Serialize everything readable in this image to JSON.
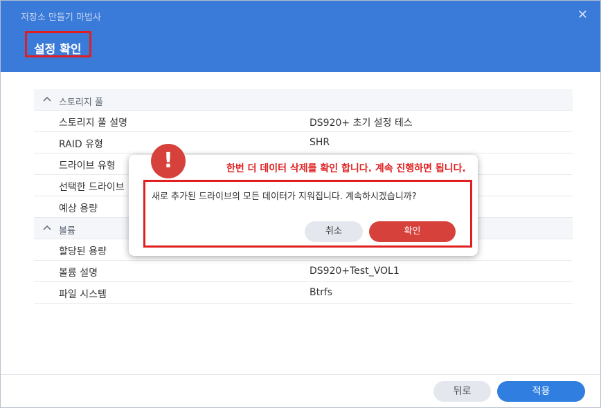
{
  "window": {
    "title": "저장소 만들기 마법사",
    "close_icon": "close-icon",
    "step_title": "설정 확인"
  },
  "sections": [
    {
      "title": "스토리지 풀",
      "rows": [
        {
          "key": "스토리지 풀 설명",
          "value": "DS920+ 초기 설정 테스"
        },
        {
          "key": "RAID 유형",
          "value": "SHR"
        },
        {
          "key": "드라이브 유형",
          "value": ""
        },
        {
          "key": "선택한 드라이브",
          "value": ""
        },
        {
          "key": "예상 용량",
          "value": ""
        }
      ]
    },
    {
      "title": "볼륨",
      "rows": [
        {
          "key": "할당된 용량",
          "value": ""
        },
        {
          "key": "볼륨 설명",
          "value": "DS920+Test_VOL1"
        },
        {
          "key": "파일 시스템",
          "value": "Btrfs"
        }
      ]
    }
  ],
  "footer": {
    "back_label": "뒤로",
    "apply_label": "적용"
  },
  "dialog": {
    "icon": "exclamation-icon",
    "icon_glyph": "!",
    "annotation": "한번 더 데이터 삭제를 확인 합니다. 계속 진행하면 됩니다.",
    "message": "새로 추가된 드라이브의 모든 데이터가 지워집니다. 계속하시겠습니까?",
    "cancel_label": "취소",
    "ok_label": "확인"
  },
  "colors": {
    "header": "#3a7ad8",
    "primary_button": "#2f7ee0",
    "danger_button": "#d6413b",
    "annotation_red": "#e02020"
  }
}
